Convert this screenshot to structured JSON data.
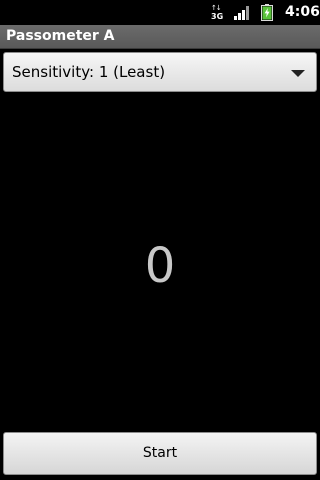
{
  "status_bar": {
    "network_type": "3G",
    "network_arrows": "↑↓",
    "time": "4:06",
    "icons": [
      "network-3g-icon",
      "signal-icon",
      "battery-charging-icon"
    ],
    "battery_color": "#59c23a"
  },
  "app": {
    "title": "Passometer A"
  },
  "sensitivity": {
    "selected": "Sensitivity: 1 (Least)"
  },
  "counter": {
    "value": "0"
  },
  "actions": {
    "start_label": "Start"
  }
}
